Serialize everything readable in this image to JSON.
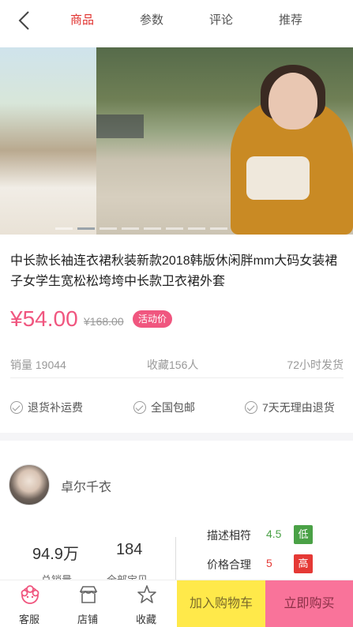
{
  "header": {
    "tabs": [
      {
        "label": "商品"
      },
      {
        "label": "参数"
      },
      {
        "label": "评论"
      },
      {
        "label": "推荐"
      }
    ]
  },
  "product": {
    "title": "中长款长袖连衣裙秋装新款2018韩版休闲胖mm大码女装裙子女学生宽松松垮垮中长款卫衣裙外套",
    "price": "¥54.00",
    "old_price": "¥168.00",
    "badge": "活动价",
    "sales": "销量 19044",
    "favorites": "收藏156人",
    "shipping": "72小时发货",
    "services": [
      "退货补运费",
      "全国包邮",
      "7天无理由退货"
    ]
  },
  "shop": {
    "name": "卓尔千衣",
    "stat1_value": "94.9万",
    "stat1_label": "总销量",
    "stat2_value": "184",
    "stat2_label": "全部宝贝",
    "ratings": [
      {
        "label": "描述相符",
        "score": "4.5",
        "level": "低",
        "color": "#4aa146"
      },
      {
        "label": "价格合理",
        "score": "5",
        "level": "高",
        "color": "#e53935"
      }
    ]
  },
  "bottom_bar": {
    "service": "客服",
    "store": "店铺",
    "favorite": "收藏",
    "add_to_cart": "加入购物车",
    "buy_now": "立即购买"
  },
  "colors": {
    "accent": "#f0567f",
    "active_tab": "#e0302d",
    "cart": "#ffe94a",
    "buy": "#f9739a"
  }
}
